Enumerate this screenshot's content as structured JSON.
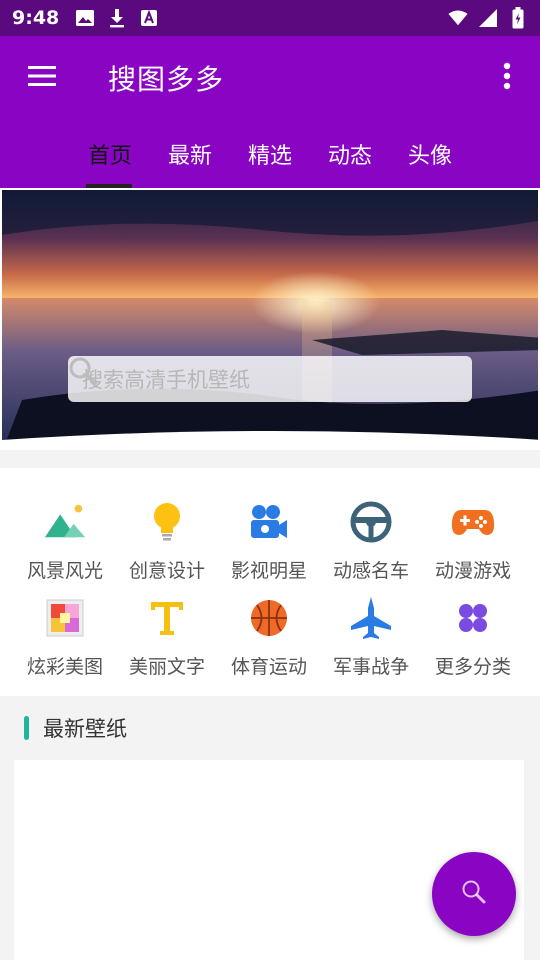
{
  "status_bar": {
    "time": "9:48",
    "left_icons": [
      "image-icon",
      "download-icon",
      "a-icon"
    ],
    "right_icons": [
      "wifi-icon",
      "signal-icon",
      "battery-icon"
    ]
  },
  "app_bar": {
    "title": "搜图多多",
    "menu_icon": "menu-icon",
    "more_icon": "more-vert-icon"
  },
  "tabs": [
    {
      "label": "首页",
      "active": true
    },
    {
      "label": "最新",
      "active": false
    },
    {
      "label": "精选",
      "active": false
    },
    {
      "label": "动态",
      "active": false
    },
    {
      "label": "头像",
      "active": false
    }
  ],
  "banner": {
    "search_placeholder": "搜索高清手机壁纸"
  },
  "categories": [
    {
      "label": "风景风光",
      "icon": "landscape-icon"
    },
    {
      "label": "创意设计",
      "icon": "lightbulb-icon"
    },
    {
      "label": "影视明星",
      "icon": "movie-camera-icon"
    },
    {
      "label": "动感名车",
      "icon": "steering-wheel-icon"
    },
    {
      "label": "动漫游戏",
      "icon": "gamepad-icon"
    },
    {
      "label": "炫彩美图",
      "icon": "palette-icon"
    },
    {
      "label": "美丽文字",
      "icon": "text-t-icon"
    },
    {
      "label": "体育运动",
      "icon": "basketball-icon"
    },
    {
      "label": "军事战争",
      "icon": "fighter-jet-icon"
    },
    {
      "label": "更多分类",
      "icon": "more-grid-icon"
    }
  ],
  "section": {
    "title": "最新壁纸"
  },
  "fab": {
    "icon": "search-icon"
  },
  "colors": {
    "primary": "#8a05c3",
    "status_bar": "#5a0a7e",
    "accent": "#1fb59a"
  }
}
